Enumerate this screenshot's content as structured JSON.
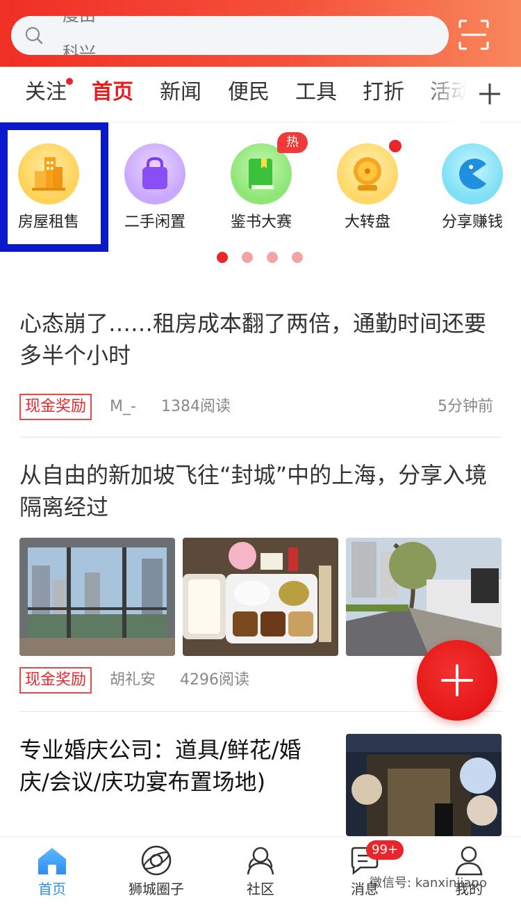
{
  "search": {
    "placeholder_line1": "度由",
    "placeholder_line2": "科兴"
  },
  "tabs": [
    {
      "label": "关注",
      "has_dot": true
    },
    {
      "label": "首页",
      "active": true
    },
    {
      "label": "新闻"
    },
    {
      "label": "便民"
    },
    {
      "label": "工具"
    },
    {
      "label": "打折"
    },
    {
      "label": "活动"
    }
  ],
  "quick_icons": [
    {
      "label": "房屋租售",
      "icon": "building-icon",
      "highlighted": true
    },
    {
      "label": "二手闲置",
      "icon": "shopping-bag-icon"
    },
    {
      "label": "鉴书大赛",
      "icon": "book-icon",
      "badge": "热"
    },
    {
      "label": "大转盘",
      "icon": "prize-wheel-icon",
      "has_dot": true
    },
    {
      "label": "分享赚钱",
      "icon": "pacman-icon"
    }
  ],
  "pager": {
    "count": 4,
    "active_index": 0
  },
  "articles": [
    {
      "title": "心态崩了……租房成本翻了两倍，通勤时间还要多半个小时",
      "tag": "现金奖励",
      "author": "M_-",
      "reads": "1384阅读",
      "time": "5分钟前"
    },
    {
      "title": "从自由的新加坡飞往“封城”中的上海，分享入境隔离经过",
      "tag": "现金奖励",
      "author": "胡礼安",
      "reads": "4296阅读",
      "images": [
        "window-view-photo",
        "quarantine-meal-photo",
        "street-photo"
      ]
    },
    {
      "title": "专业婚庆公司：道具/鲜花/婚庆/会议/庆功宴布置场地)",
      "image": "wedding-venue-photo"
    }
  ],
  "bottom_nav": [
    {
      "label": "首页",
      "icon": "home-icon",
      "active": true
    },
    {
      "label": "狮城圈子",
      "icon": "planet-icon"
    },
    {
      "label": "社区",
      "icon": "community-icon"
    },
    {
      "label": "消息",
      "icon": "chat-icon",
      "badge": "99+"
    },
    {
      "label": "我的",
      "icon": "profile-icon"
    }
  ],
  "watermark": "微信号: kanxinjiapo",
  "colors": {
    "brand_red": "#e51d1d",
    "nav_active": "#2a8ef3",
    "highlight_box": "#0a19c9"
  }
}
